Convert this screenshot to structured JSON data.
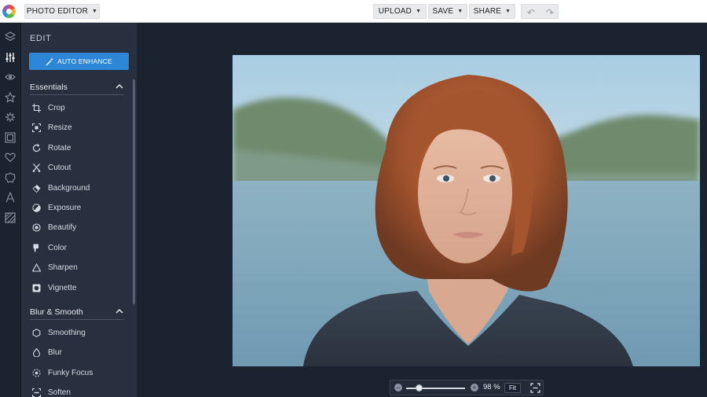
{
  "topbar": {
    "app_menu": "PHOTO EDITOR",
    "upload": "UPLOAD",
    "save": "SAVE",
    "share": "SHARE"
  },
  "panel": {
    "title": "EDIT",
    "auto_enhance": "AUTO ENHANCE",
    "sections": [
      {
        "title": "Essentials",
        "tools": [
          {
            "label": "Crop",
            "icon": "crop-icon"
          },
          {
            "label": "Resize",
            "icon": "resize-icon"
          },
          {
            "label": "Rotate",
            "icon": "rotate-icon"
          },
          {
            "label": "Cutout",
            "icon": "scissors-icon"
          },
          {
            "label": "Background",
            "icon": "eraser-icon"
          },
          {
            "label": "Exposure",
            "icon": "exposure-icon"
          },
          {
            "label": "Beautify",
            "icon": "target-icon"
          },
          {
            "label": "Color",
            "icon": "paint-bucket-icon"
          },
          {
            "label": "Sharpen",
            "icon": "triangle-icon"
          },
          {
            "label": "Vignette",
            "icon": "vignette-icon"
          }
        ]
      },
      {
        "title": "Blur & Smooth",
        "tools": [
          {
            "label": "Smoothing",
            "icon": "hexagon-icon"
          },
          {
            "label": "Blur",
            "icon": "blur-drop-icon"
          },
          {
            "label": "Funky Focus",
            "icon": "focus-icon"
          },
          {
            "label": "Soften",
            "icon": "soften-icon"
          }
        ]
      }
    ]
  },
  "rail_icons": [
    "layers-icon",
    "sliders-icon",
    "eye-icon",
    "star-icon",
    "gear-icon",
    "frame-icon",
    "heart-icon",
    "badge-icon",
    "text-icon",
    "texture-icon"
  ],
  "zoom": {
    "level_percent": 98,
    "label": "98 %",
    "fit_label": "Fit"
  },
  "colors": {
    "accent": "#2d86d6",
    "panel_bg": "#283040",
    "app_bg": "#1c2330"
  }
}
